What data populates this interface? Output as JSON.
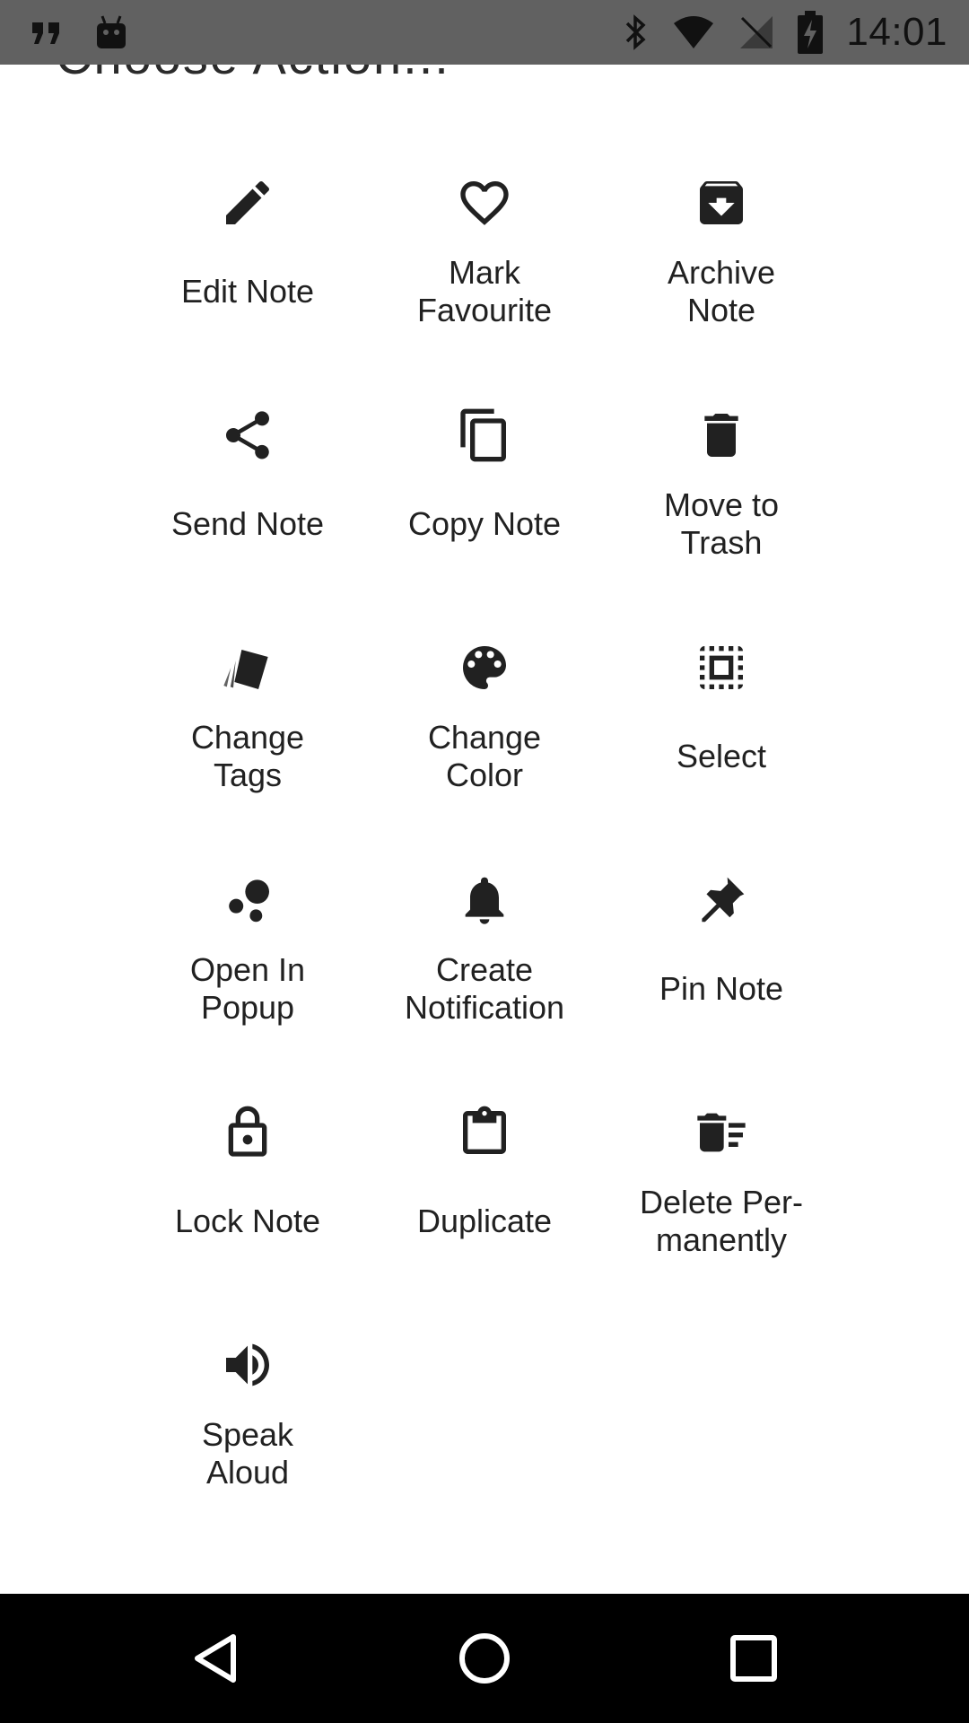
{
  "status_bar": {
    "time": "14:01",
    "left_icons": [
      "quote-icon",
      "android-icon"
    ],
    "right_icons": [
      "bluetooth-icon",
      "wifi-icon",
      "no-sim-icon",
      "battery-charging-icon"
    ]
  },
  "dialog": {
    "title": "Choose Action..."
  },
  "actions": [
    {
      "label": "Edit Note",
      "icon": "pencil-icon"
    },
    {
      "label": "Mark\nFavourite",
      "icon": "heart-icon"
    },
    {
      "label": "Archive\nNote",
      "icon": "archive-icon"
    },
    {
      "label": "Send Note",
      "icon": "share-icon"
    },
    {
      "label": "Copy Note",
      "icon": "copy-icon"
    },
    {
      "label": "Move to\nTrash",
      "icon": "trash-icon"
    },
    {
      "label": "Change\nTags",
      "icon": "tags-icon"
    },
    {
      "label": "Change\nColor",
      "icon": "palette-icon"
    },
    {
      "label": "Select",
      "icon": "select-icon"
    },
    {
      "label": "Open In\nPopup",
      "icon": "bubbles-icon"
    },
    {
      "label": "Create\nNotification",
      "icon": "bell-icon"
    },
    {
      "label": "Pin Note",
      "icon": "pin-icon"
    },
    {
      "label": "Lock Note",
      "icon": "lock-icon"
    },
    {
      "label": "Duplicate",
      "icon": "clipboard-icon"
    },
    {
      "label": "Delete Per-\nmanently",
      "icon": "delete-forever-icon"
    },
    {
      "label": "Speak\nAloud",
      "icon": "speaker-icon"
    }
  ],
  "nav_bar": {
    "icons": [
      "back-icon",
      "home-icon",
      "recents-icon"
    ]
  }
}
